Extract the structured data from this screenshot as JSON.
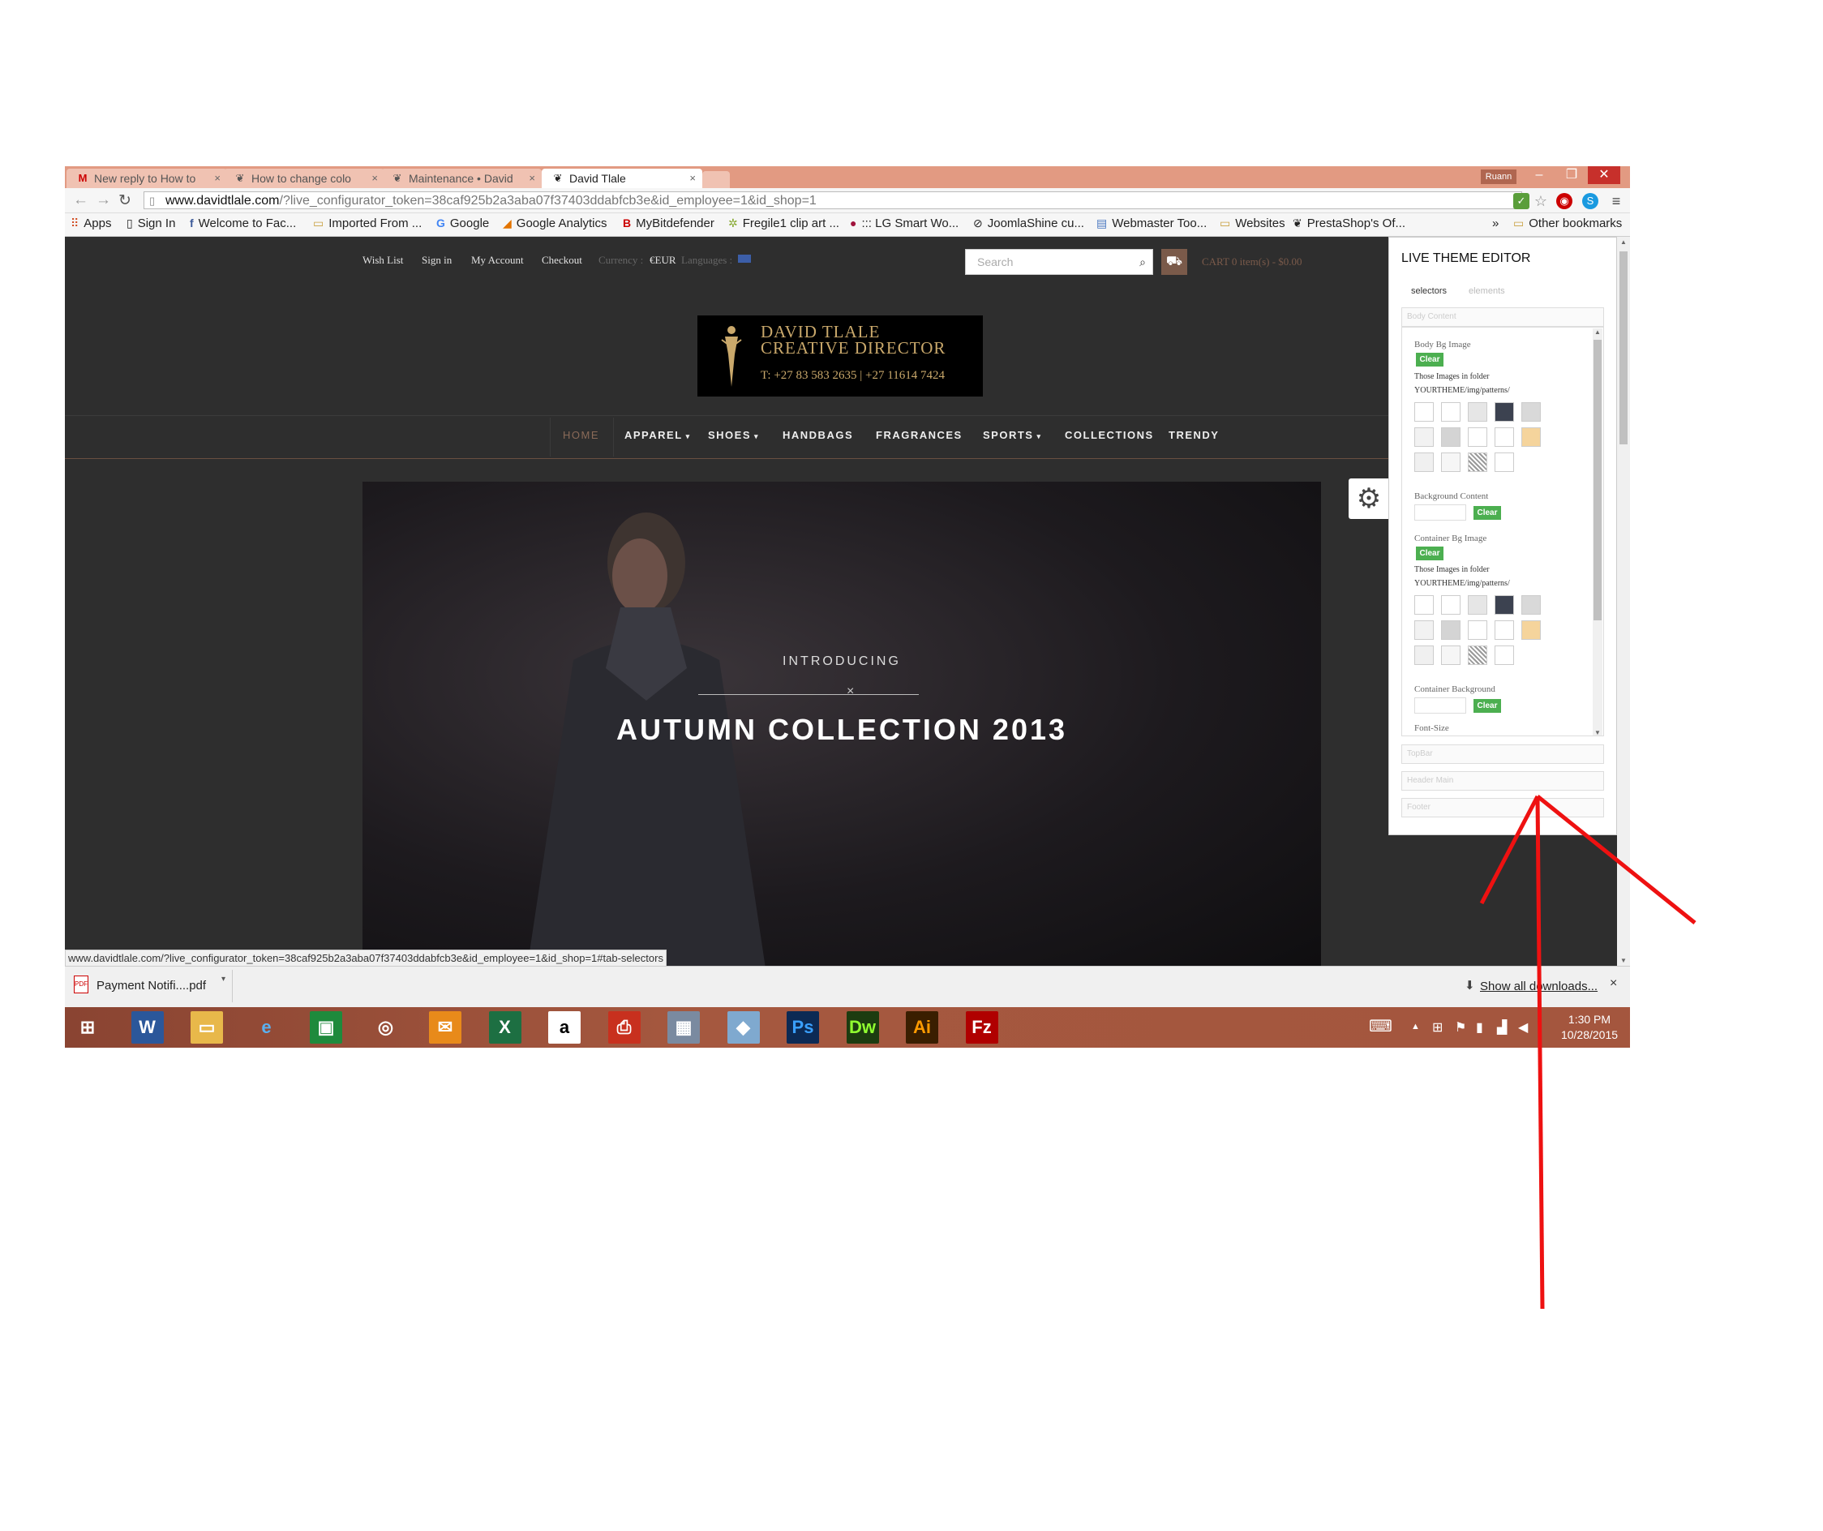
{
  "browser": {
    "tabs": [
      {
        "label": "New reply to How to",
        "icon": "gmail-icon",
        "active": false
      },
      {
        "label": "How to change colo",
        "icon": "prestashop-icon",
        "active": false
      },
      {
        "label": "Maintenance • David",
        "icon": "prestashop-icon",
        "active": false
      },
      {
        "label": "David Tlale",
        "icon": "prestashop-icon",
        "active": true
      }
    ],
    "profile": "Ruann",
    "url_host": "www.davidtlale.com",
    "url_rest": "/?live_configurator_token=38caf925b2a3aba07f37403ddabfcb3e&id_employee=1&id_shop=1",
    "bookmarks": [
      {
        "label": "Apps",
        "icon": "apps-icon"
      },
      {
        "label": "Sign In",
        "icon": "page-icon"
      },
      {
        "label": "Welcome to Fac...",
        "icon": "facebook-icon"
      },
      {
        "label": "Imported From ...",
        "icon": "folder-icon"
      },
      {
        "label": "Google",
        "icon": "google-icon"
      },
      {
        "label": "Google Analytics",
        "icon": "analytics-icon"
      },
      {
        "label": "MyBitdefender",
        "icon": "bitdefender-icon"
      },
      {
        "label": "Fregile1 clip art ...",
        "icon": "clipart-icon"
      },
      {
        "label": "::: LG Smart Wo...",
        "icon": "lg-icon"
      },
      {
        "label": "JoomlaShine cu...",
        "icon": "joomla-icon"
      },
      {
        "label": "Webmaster Too...",
        "icon": "webmaster-icon"
      },
      {
        "label": "Websites",
        "icon": "folder-icon"
      },
      {
        "label": "PrestaShop's Of...",
        "icon": "prestashop-icon"
      }
    ],
    "bookmarks_overflow": "»",
    "other_bookmarks": "Other bookmarks",
    "status_url": "www.davidtlale.com/?live_configurator_token=38caf925b2a3aba07f37403ddabfcb3e&id_employee=1&id_shop=1#tab-selectors"
  },
  "site": {
    "top_links": [
      "Wish List",
      "Sign in",
      "My Account",
      "Checkout"
    ],
    "currency_label": "Currency :",
    "currency_value": "€EUR",
    "languages_label": "Languages :",
    "search_placeholder": "Search",
    "cart_text": "CART 0 item(s) - $0.00",
    "logo": {
      "line1": "DAVID TLALE",
      "line2": "CREATIVE DIRECTOR",
      "phone": "T: +27 83 583 2635 | +27 11614 7424"
    },
    "menu": [
      "HOME",
      "APPAREL",
      "SHOES",
      "HANDBAGS",
      "FRAGRANCES",
      "SPORTS",
      "COLLECTIONS",
      "TRENDY"
    ],
    "menu_dropdown": [
      false,
      true,
      true,
      false,
      false,
      true,
      false,
      false
    ],
    "hero": {
      "intro": "INTRODUCING",
      "title": "AUTUMN COLLECTION 2013"
    }
  },
  "editor": {
    "title": "LIVE THEME EDITOR",
    "tabs": [
      "selectors",
      "elements"
    ],
    "sections": [
      "Body Content",
      "TopBar",
      "Header Main",
      "Footer"
    ],
    "body_bg_label": "Body Bg Image",
    "clear_label": "Clear",
    "folder_note_1": "Those Images in folder",
    "folder_note_2": "YOURTHEME/img/patterns/",
    "bg_content_label": "Background Content",
    "container_bg_label": "Container Bg Image",
    "container_background_label": "Container Background",
    "font_size_label": "Font-Size",
    "swatch_colors": [
      "#ffffff",
      "#ffffff",
      "#e6e6e6",
      "#3c4250",
      "#d9d9d9",
      "#f2f2f2",
      "#d4d4d4",
      "#ffffff",
      "#ffffff",
      "#f5d49c",
      "#f0f0f0",
      "#f6f6f6",
      "#c8c8c8",
      "#ffffff"
    ]
  },
  "downloads": {
    "file": "Payment Notifi....pdf",
    "show_all": "Show all downloads...",
    "close": "×"
  },
  "taskbar": {
    "apps": [
      "windows-start-icon",
      "word-icon",
      "file-explorer-icon",
      "internet-explorer-icon",
      "store-icon",
      "chrome-icon",
      "outlook-icon",
      "excel-icon",
      "amazon-icon",
      "acrobat-icon",
      "calculator-icon",
      "app-icon",
      "photoshop-icon",
      "dreamweaver-icon",
      "illustrator-icon",
      "filezilla-icon"
    ],
    "app_labels": [
      "",
      "W",
      "",
      "e",
      "",
      "",
      "",
      "X",
      "a",
      "",
      "",
      "",
      "Ps",
      "Dw",
      "Ai",
      "Fz"
    ],
    "time": "1:30 PM",
    "date": "10/28/2015"
  },
  "colors": {
    "accent_brown": "#7a5a4a",
    "clear_green": "#4caf50",
    "logo_gold": "#c9a86b",
    "annotation_red": "#ee1111"
  }
}
